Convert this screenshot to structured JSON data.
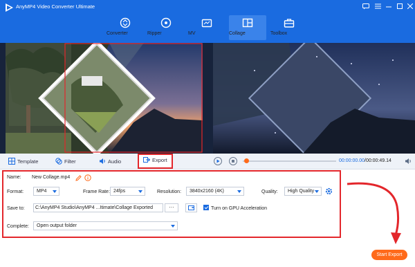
{
  "app": {
    "title": "AnyMP4 Video Converter Ultimate"
  },
  "window_controls": [
    "message-icon",
    "menu-icon",
    "minimize-icon",
    "maximize-icon",
    "close-icon"
  ],
  "nav": {
    "tabs": [
      {
        "label": "Converter",
        "icon": "converter-icon",
        "active": false
      },
      {
        "label": "Ripper",
        "icon": "ripper-icon",
        "active": false
      },
      {
        "label": "MV",
        "icon": "mv-icon",
        "active": false
      },
      {
        "label": "Collage",
        "icon": "collage-icon",
        "active": true
      },
      {
        "label": "Toolbox",
        "icon": "toolbox-icon",
        "active": false
      }
    ]
  },
  "editor_tabs": {
    "template": "Template",
    "filter": "Filter",
    "audio": "Audio",
    "export": "Export"
  },
  "playback": {
    "current_time": "00:00:00.00",
    "total_time": "00:00:49.14",
    "progress": 0.02
  },
  "export": {
    "name_label": "Name:",
    "name_value": "New Collage.mp4",
    "format_label": "Format:",
    "format_value": "MP4",
    "frame_rate_label": "Frame Rate:",
    "frame_rate_value": "24fps",
    "resolution_label": "Resolution:",
    "resolution_value": "3840x2160 (4K)",
    "quality_label": "Quality:",
    "quality_value": "High Quality",
    "save_to_label": "Save to:",
    "save_to_value": "C:\\AnyMP4 Studio\\AnyMP4 ...Itimate\\Collage Exported",
    "browse_label": "···",
    "gpu_label": "Turn on GPU Acceleration",
    "gpu_checked": true,
    "complete_label": "Complete:",
    "complete_value": "Open output folder"
  },
  "start_export": "Start Export",
  "colors": {
    "brand_blue": "#1a6be0",
    "accent_orange": "#ff6a1a",
    "highlight_red": "#e3262b"
  }
}
